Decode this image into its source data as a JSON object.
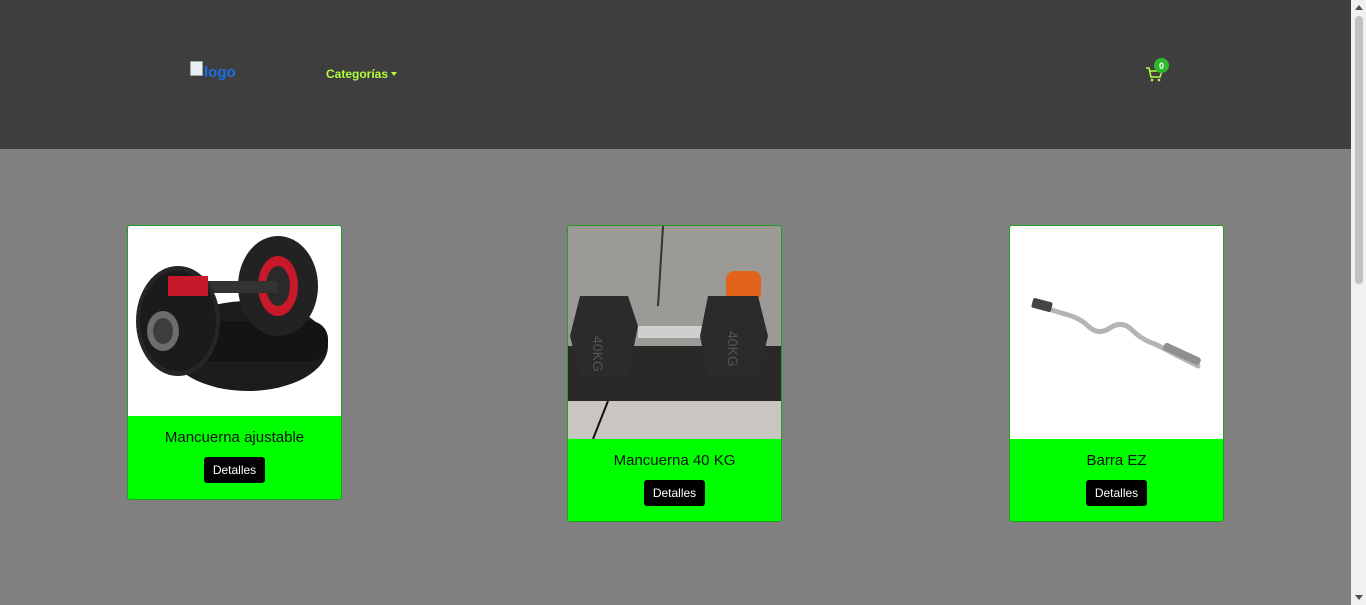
{
  "header": {
    "logo_alt": "logo",
    "categories_label": "Categorías",
    "cart_count": "0"
  },
  "products": [
    {
      "name": "Mancuerna ajustable",
      "button": "Detalles",
      "image_icon": "adjustable-dumbbell-image"
    },
    {
      "name": "Mancuerna 40 KG",
      "button": "Detalles",
      "image_icon": "hex-dumbbell-image"
    },
    {
      "name": "Barra EZ",
      "button": "Detalles",
      "image_icon": "ez-bar-image"
    }
  ],
  "colors": {
    "header_bg": "#3e3e3e",
    "page_bg": "#808080",
    "card_footer": "#00ff00",
    "accent": "#b3ff3d"
  }
}
